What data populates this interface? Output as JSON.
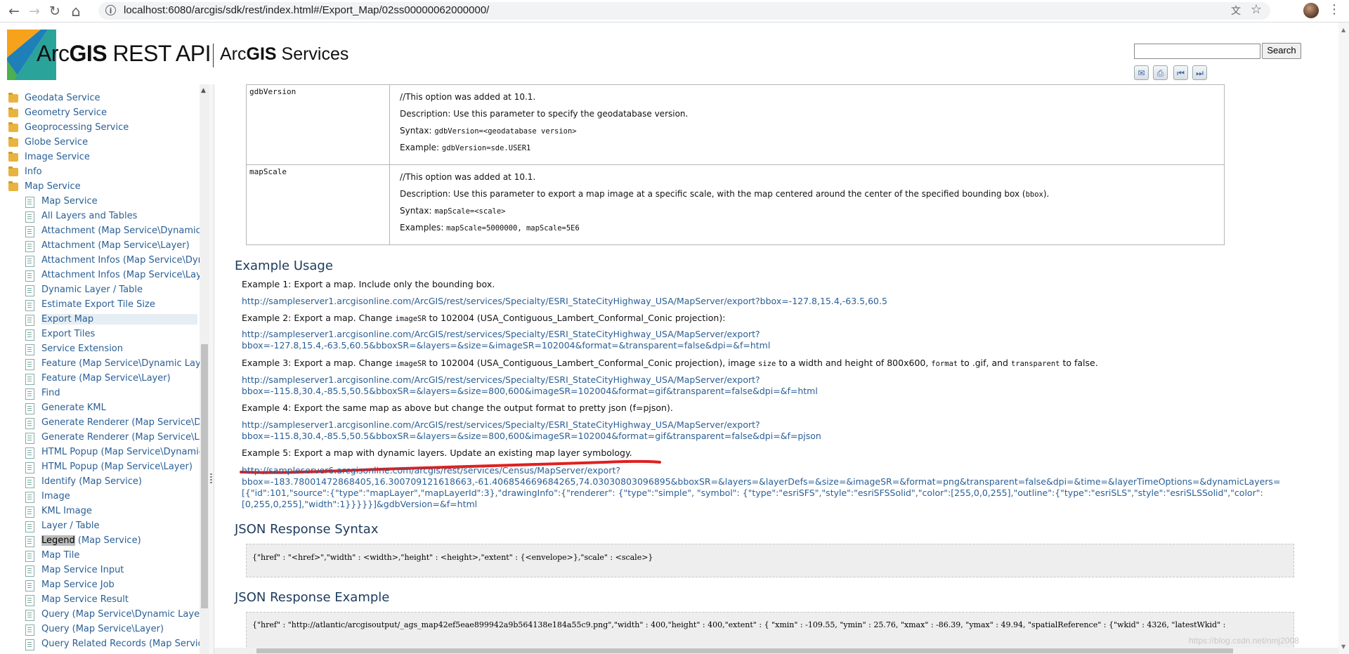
{
  "browser": {
    "url": "localhost:6080/arcgis/sdk/rest/index.html#/Export_Map/02ss00000062000000/",
    "back_icon": "←",
    "forward_icon": "→",
    "reload_icon": "↻",
    "home_icon": "⌂",
    "menu_icon": "⋮",
    "translate_icon": "文",
    "star_icon": "☆",
    "info_icon": "i"
  },
  "header": {
    "brand_prefix": "Arc",
    "brand_bold": "GIS",
    "brand_suffix": " REST API",
    "services_prefix": "Arc",
    "services_bold": "GIS",
    "services_suffix": " Services",
    "search_placeholder": "",
    "search_button": "Search",
    "tools": [
      "✉",
      "⎙",
      "⏮",
      "⏭"
    ]
  },
  "sidebar": {
    "items": [
      {
        "label": "Geodata Service",
        "type": "folder"
      },
      {
        "label": "Geometry Service",
        "type": "folder"
      },
      {
        "label": "Geoprocessing Service",
        "type": "folder"
      },
      {
        "label": "Globe Service",
        "type": "folder"
      },
      {
        "label": "Image Service",
        "type": "folder"
      },
      {
        "label": "Info",
        "type": "folder"
      },
      {
        "label": "Map Service",
        "type": "folder-open"
      },
      {
        "label": "Map Service",
        "type": "doc"
      },
      {
        "label": "All Layers and Tables",
        "type": "doc"
      },
      {
        "label": "Attachment (Map Service\\Dynamic L",
        "type": "doc"
      },
      {
        "label": "Attachment (Map Service\\Layer)",
        "type": "doc"
      },
      {
        "label": "Attachment Infos (Map Service\\Dyna",
        "type": "doc"
      },
      {
        "label": "Attachment Infos (Map Service\\Layer",
        "type": "doc"
      },
      {
        "label": "Dynamic Layer / Table",
        "type": "doc"
      },
      {
        "label": "Estimate Export Tile Size",
        "type": "doc"
      },
      {
        "label": "Export Map",
        "type": "doc",
        "selected": true
      },
      {
        "label": "Export Tiles",
        "type": "doc"
      },
      {
        "label": "Service Extension",
        "type": "doc"
      },
      {
        "label": "Feature (Map Service\\Dynamic Layer",
        "type": "doc"
      },
      {
        "label": "Feature (Map Service\\Layer)",
        "type": "doc"
      },
      {
        "label": "Find",
        "type": "doc"
      },
      {
        "label": "Generate KML",
        "type": "doc"
      },
      {
        "label": "Generate Renderer (Map Service\\Dyr",
        "type": "doc"
      },
      {
        "label": "Generate Renderer (Map Service\\Lay",
        "type": "doc"
      },
      {
        "label": "HTML Popup (Map Service\\Dynamic L",
        "type": "doc"
      },
      {
        "label": "HTML Popup (Map Service\\Layer)",
        "type": "doc"
      },
      {
        "label": "Identify (Map Service)",
        "type": "doc"
      },
      {
        "label": "Image",
        "type": "doc"
      },
      {
        "label": "KML Image",
        "type": "doc"
      },
      {
        "label": "Layer / Table",
        "type": "doc"
      },
      {
        "label": "Legend (Map Service)",
        "type": "doc",
        "highlight": "Legend"
      },
      {
        "label": "Map Tile",
        "type": "doc"
      },
      {
        "label": "Map Service Input",
        "type": "doc"
      },
      {
        "label": "Map Service Job",
        "type": "doc"
      },
      {
        "label": "Map Service Result",
        "type": "doc"
      },
      {
        "label": "Query (Map Service\\Dynamic Layer)",
        "type": "doc"
      },
      {
        "label": "Query (Map Service\\Layer)",
        "type": "doc"
      },
      {
        "label": "Query Related Records (Map Service\\",
        "type": "doc"
      }
    ]
  },
  "params": [
    {
      "name": "gdbVersion",
      "lines": [
        {
          "text": "//This option was added at 10.1."
        },
        {
          "text": "Description: Use this parameter to specify the geodatabase version."
        },
        {
          "label": "Syntax: ",
          "mono": "gdbVersion=<geodatabase version>"
        },
        {
          "label": "Example: ",
          "mono": "gdbVersion=sde.USER1"
        }
      ]
    },
    {
      "name": "mapScale",
      "lines": [
        {
          "text": "//This option was added at 10.1."
        },
        {
          "text": "Description: Use this parameter to export a map image at a specific scale, with the map centered around the center of the specified bounding box (",
          "mono": "bbox",
          "after": ")."
        },
        {
          "label": "Syntax: ",
          "mono": "mapScale=<scale>"
        },
        {
          "label": "Examples: ",
          "mono": "mapScale=5000000, mapScale=5E6"
        }
      ]
    }
  ],
  "example_usage": {
    "heading": "Example Usage",
    "examples": [
      {
        "desc": "Example 1: Export a map. Include only the bounding box.",
        "link": "http://sampleserver1.arcgisonline.com/ArcGIS/rest/services/Specialty/ESRI_StateCityHighway_USA/MapServer/export?bbox=-127.8,15.4,-63.5,60.5"
      },
      {
        "desc_parts": [
          "Example 2: Export a map. Change ",
          "imageSR",
          " to 102004 (USA_Contiguous_Lambert_Conformal_Conic projection):"
        ],
        "link": "http://sampleserver1.arcgisonline.com/ArcGIS/rest/services/Specialty/ESRI_StateCityHighway_USA/MapServer/export?\nbbox=-127.8,15.4,-63.5,60.5&bboxSR=&layers=&size=&imageSR=102004&format=&transparent=false&dpi=&f=html"
      },
      {
        "desc_parts": [
          "Example 3: Export a map. Change ",
          "imageSR",
          " to 102004 (USA_Contiguous_Lambert_Conformal_Conic projection), image ",
          "size",
          " to a width and height of 800x600, ",
          "format",
          " to .gif, and ",
          "transparent",
          " to false."
        ],
        "link": "http://sampleserver1.arcgisonline.com/ArcGIS/rest/services/Specialty/ESRI_StateCityHighway_USA/MapServer/export?\nbbox=-115.8,30.4,-85.5,50.5&bboxSR=&layers=&size=800,600&imageSR=102004&format=gif&transparent=false&dpi=&f=html"
      },
      {
        "desc": "Example 4: Export the same map as above but change the output format to pretty json (f=pjson).",
        "link": "http://sampleserver1.arcgisonline.com/ArcGIS/rest/services/Specialty/ESRI_StateCityHighway_USA/MapServer/export?\nbbox=-115.8,30.4,-85.5,50.5&bboxSR=&layers=&size=800,600&imageSR=102004&format=gif&transparent=false&dpi=&f=pjson"
      },
      {
        "desc": "Example 5: Export a map with dynamic layers. Update an existing map layer symbology.",
        "link": "http://sampleserver6.arcgisonline.com/arcgis/rest/services/Census/MapServer/export?\nbbox=-183.78001472868405,16.300709121618663,-61.406854669684265,74.03030803096895&bboxSR=&layers=&layerDefs=&size=&imageSR=&format=png&transparent=false&dpi=&time=&layerTimeOptions=&dynamicLayers=\n[{\"id\":101,\"source\":{\"type\":\"mapLayer\",\"mapLayerId\":3},\"drawingInfo\":{\"renderer\": {\"type\":\"simple\", \"symbol\": {\"type\":\"esriSFS\",\"style\":\"esriSFSSolid\",\"color\":[255,0,0,255],\"outline\":{\"type\":\"esriSLS\",\"style\":\"esriSLSSolid\",\"color\":\n[0,255,0,255],\"width\":1}}}}}]&gdbVersion=&f=html"
      }
    ]
  },
  "json_syntax": {
    "heading": "JSON Response Syntax",
    "code": "{\"href\" : \"<href>\",\"width\" : <width>,\"height\" : <height>,\"extent\" : {<envelope>},\"scale\" : <scale>}"
  },
  "json_example": {
    "heading": "JSON Response Example",
    "code": "{\"href\" : \"http://atlantic/arcgisoutput/_ags_map42ef5eae899942a9b564138e184a55c9.png\",\"width\" : 400,\"height\" : 400,\"extent\" : { \"xmin\" : -109.55, \"ymin\" : 25.76, \"xmax\" : -86.39, \"ymax\" : 49.94, \"spatialReference\" : {\"wkid\" : 4326, \"latestWkid\" :"
  },
  "watermark": "https://blog.csdn.net/nmj2008",
  "colors": {
    "link": "#2a5f95",
    "annotation": "#e02020",
    "heading": "#1d3b5c"
  }
}
